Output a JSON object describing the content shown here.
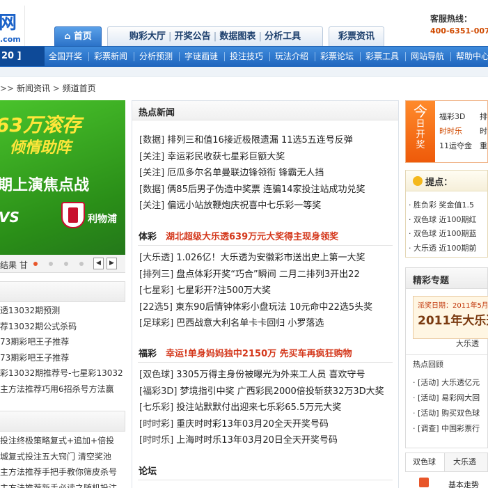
{
  "header": {
    "logo": {
      "big": "网",
      "sub": ".com"
    },
    "tabs": [
      {
        "label": "首页",
        "active": true
      },
      {
        "label": "购彩大厅"
      },
      {
        "label": "开奖公告"
      },
      {
        "label": "数据图表"
      },
      {
        "label": "分析工具"
      },
      {
        "label": "彩票资讯"
      }
    ],
    "hotline_label": "客服热线：",
    "hotline_number": "400-6351-007"
  },
  "navbar": {
    "left": "20 ]",
    "items": [
      "全国开奖",
      "彩票新闻",
      "分析预测",
      "字谜画谜",
      "投注技巧",
      "玩法介绍",
      "彩票论坛",
      "彩票工具",
      "网站导航",
      "帮助中心"
    ]
  },
  "breadcrumb": {
    "arrows": ">>",
    "items": [
      "新闻资讯",
      "频道首页"
    ],
    "separator": ">"
  },
  "banner": {
    "line1": "63万滚存",
    "line2": "倾情助阵",
    "line3": "期上演焦点战",
    "vs": "VS",
    "team": "利物浦",
    "caption": "结果 甘",
    "prev": "◀",
    "next": "▶"
  },
  "left_list1": [
    "透13032期预测",
    "荐13032期公式杀码",
    "73期彩吧王子推荐",
    "73期彩吧王子推荐",
    "彩13032期推荐号-七星彩13032",
    "主方法推荐巧用6招杀号方法赢"
  ],
  "left_list2": [
    "投注终极策略复式+追加+倍投",
    "城复式投注五大窍门 清空奖池",
    "主方法推荐手把手教你筛皮杀号",
    "主方法推荐新手必读之随机投注"
  ],
  "hot_news": {
    "title": "热点新闻",
    "items": [
      {
        "cat": "[数据]",
        "text": "排列三和值16接近极限遗漏 11选5五连号反弹"
      },
      {
        "cat": "[关注]",
        "text": "幸运彩民收获七星彩巨额大奖"
      },
      {
        "cat": "[关注]",
        "text": "厄瓜多尔名单曼联边锋领衔 锋霸无人挡"
      },
      {
        "cat": "[数据]",
        "text": "俩85后男子伪造中奖票 连骗14家投注站成功兑奖"
      },
      {
        "cat": "[关注]",
        "text": "偏远小站放鞭炮庆祝喜中七乐彩一等奖"
      }
    ]
  },
  "sports": {
    "label": "体彩",
    "headline": "湖北超级大乐透639万元大奖得主现身领奖",
    "items": [
      {
        "cat": "[大乐透]",
        "text": "1.026亿！大乐透为安徽彩市送出史上第一大奖"
      },
      {
        "cat": "[排列三]",
        "text": "盘点体彩开奖“巧合”瞬间 二月二排列3开出22"
      },
      {
        "cat": "[七星彩]",
        "text": "七星彩开?注500万大奖"
      },
      {
        "cat": "[22选5]",
        "text": "東东90后情钟体彩小盘玩法 10元命中22选5头奖"
      },
      {
        "cat": "[足球彩]",
        "text": "巴西战意大利名单卡卡回归 小罗落选"
      }
    ]
  },
  "welfare": {
    "label": "福彩",
    "headline": "幸运!单身妈妈独中2150万 先买车再疯狂购物",
    "items": [
      {
        "cat": "[双色球]",
        "text": "3305万得主身份被曝光为外来工人员 喜欢守号"
      },
      {
        "cat": "[福彩3D]",
        "text": "梦境指引中奖 广西彩民2000倍投斩获32万3D大奖"
      },
      {
        "cat": "[七乐彩]",
        "text": "投注站默默付出迎来七乐彩65.5万元大奖"
      },
      {
        "cat": "[时时彩]",
        "text": "重庆时时彩13年03月20全天开奖号码"
      },
      {
        "cat": "[时时乐]",
        "text": "上海时时乐13年03月20日全天开奖号码"
      }
    ]
  },
  "forum_label": "论坛",
  "today": {
    "tag_top": "今",
    "tag_rest": [
      "日",
      "开",
      "奖"
    ],
    "rows": [
      {
        "a": "福彩3D",
        "b": "排"
      },
      {
        "a": "时时乐",
        "b": "时"
      },
      {
        "a": "11运夺金",
        "b": "重"
      }
    ]
  },
  "tips": {
    "title": "提点：",
    "items": [
      {
        "cat": "胜负彩",
        "text": "奖金值1.5"
      },
      {
        "cat": "双色球",
        "text": "近100期红"
      },
      {
        "cat": "双色球",
        "text": "近100期蓝"
      },
      {
        "cat": "大乐透",
        "text": "近100期前"
      }
    ]
  },
  "special": {
    "title": "精彩专题",
    "promo_date": "派奖日期：2011年5月",
    "promo_title": "2011年大乐透",
    "promo_caption": "大乐透",
    "review_title": "热点回顾",
    "items": [
      {
        "cat": "[活动]",
        "text": "大乐透亿元"
      },
      {
        "cat": "[活动]",
        "text": "易彩网大回"
      },
      {
        "cat": "[活动]",
        "text": "购买双色球"
      },
      {
        "cat": "[调查]",
        "text": "中国彩票行"
      }
    ]
  },
  "bottom_tabs": [
    "双色球",
    "大乐透"
  ],
  "basic_label": "基本走势",
  "colors": {
    "brand_blue": "#1b62c8",
    "nav_blue": "#2c73c9",
    "headline_red": "#d4381c",
    "today_orange": "#ee5a0a"
  }
}
